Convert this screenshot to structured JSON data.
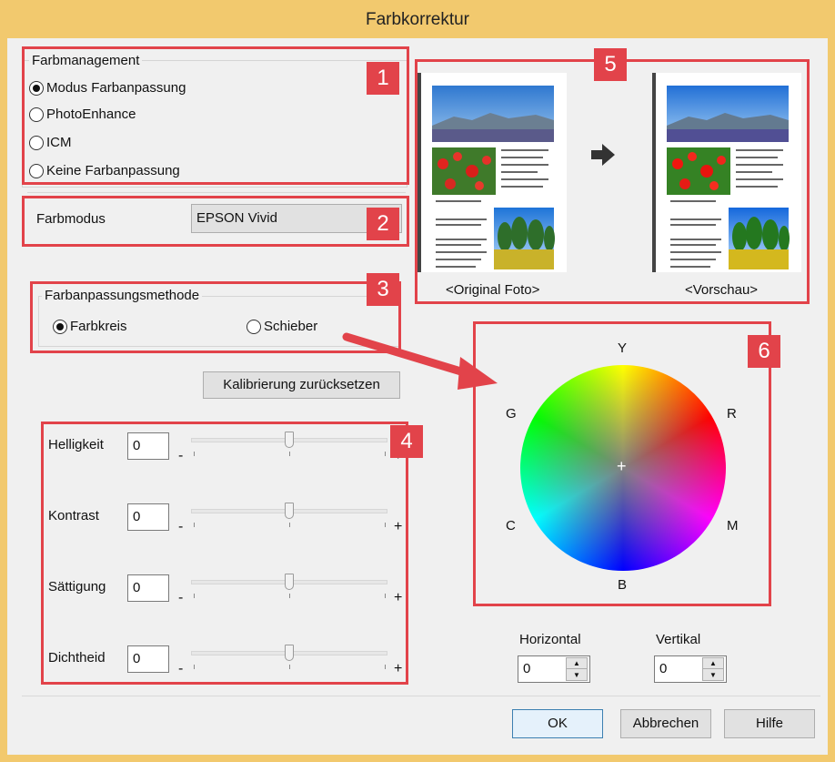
{
  "window": {
    "title": "Farbkorrektur"
  },
  "badges": [
    "1",
    "2",
    "3",
    "4",
    "5",
    "6"
  ],
  "color_management": {
    "label": "Farbmanagement",
    "options": [
      {
        "label": "Modus Farbanpassung",
        "selected": true
      },
      {
        "label": "PhotoEnhance",
        "selected": false
      },
      {
        "label": "ICM",
        "selected": false
      },
      {
        "label": "Keine Farbanpassung",
        "selected": false
      }
    ]
  },
  "color_mode": {
    "label": "Farbmodus",
    "value": "EPSON Vivid"
  },
  "method": {
    "label": "Farbanpassungsmethode",
    "options": [
      {
        "label": "Farbkreis",
        "selected": true
      },
      {
        "label": "Schieber",
        "selected": false
      }
    ]
  },
  "reset_button": "Kalibrierung zurücksetzen",
  "sliders": [
    {
      "label": "Helligkeit",
      "value": "0",
      "position": 0.5
    },
    {
      "label": "Kontrast",
      "value": "0",
      "position": 0.5
    },
    {
      "label": "Sättigung",
      "value": "0",
      "position": 0.5
    },
    {
      "label": "Dichtheid",
      "value": "0",
      "position": 0.5
    }
  ],
  "slider_signs": {
    "minus": "-",
    "plus": "+"
  },
  "preview": {
    "original_label": "<Original Foto>",
    "preview_label": "<Vorschau>"
  },
  "color_wheel": {
    "labels": {
      "y": "Y",
      "r": "R",
      "m": "M",
      "b": "B",
      "c": "C",
      "g": "G"
    },
    "center": "+"
  },
  "offset": {
    "horizontal_label": "Horizontal",
    "horizontal_value": "0",
    "vertical_label": "Vertikal",
    "vertical_value": "0"
  },
  "buttons": {
    "ok": "OK",
    "cancel": "Abbrechen",
    "help": "Hilfe"
  },
  "colors": {
    "annotation": "#e2434a",
    "window_frame": "#f2c96e",
    "client_bg": "#f0f0f0",
    "default_button": "#3c7fb1"
  },
  "icons": {
    "arrow_right": "arrow-right-icon",
    "annotation_arrow": "annotation-arrow-icon"
  }
}
